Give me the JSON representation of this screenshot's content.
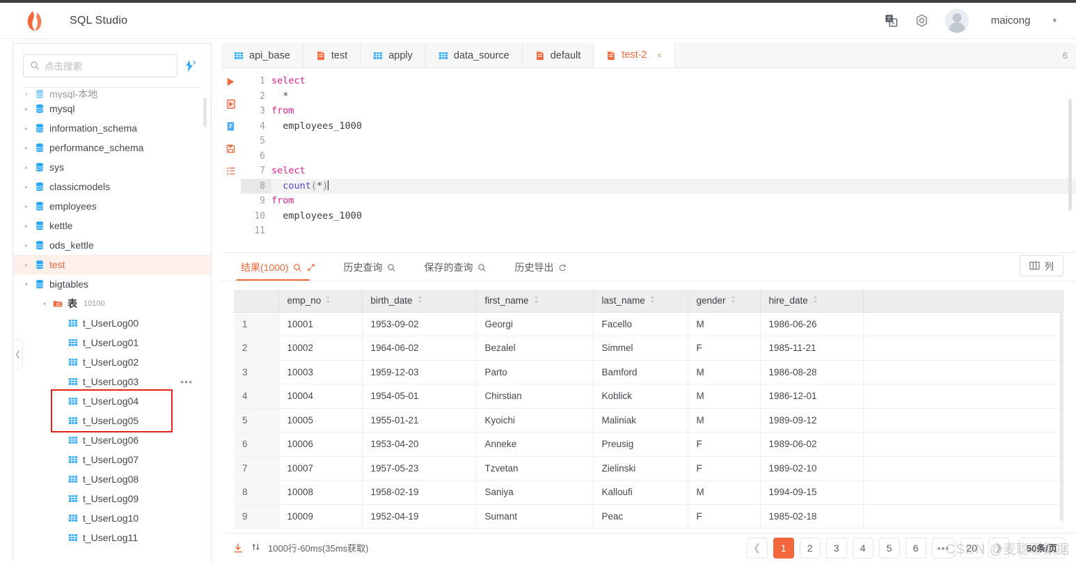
{
  "header": {
    "logo_icon": "flame-logo-icon",
    "title": "SQL Studio",
    "translate_icon": "translate-icon",
    "settings_icon": "target-settings-icon",
    "avatar_icon": "avatar",
    "user_name": "maicong",
    "caret_icon": "chevron-down-icon"
  },
  "sidebar": {
    "search": {
      "placeholder": "点击搜索",
      "icon": "search-icon"
    },
    "refresh_icon": "refresh-lightning-icon",
    "collapse_icon": "chevron-left-icon",
    "tree": [
      {
        "label": "mysql-本地",
        "type": "connection",
        "indent": 0,
        "expanded": true,
        "cut": true
      },
      {
        "label": "mysql",
        "type": "database",
        "indent": 1,
        "expanded": false
      },
      {
        "label": "information_schema",
        "type": "database",
        "indent": 1,
        "expanded": false
      },
      {
        "label": "performance_schema",
        "type": "database",
        "indent": 1,
        "expanded": false
      },
      {
        "label": "sys",
        "type": "database",
        "indent": 1,
        "expanded": false
      },
      {
        "label": "classicmodels",
        "type": "database",
        "indent": 1,
        "expanded": false
      },
      {
        "label": "employees",
        "type": "database",
        "indent": 1,
        "expanded": false
      },
      {
        "label": "kettle",
        "type": "database",
        "indent": 1,
        "expanded": false
      },
      {
        "label": "ods_kettle",
        "type": "database",
        "indent": 1,
        "expanded": false
      },
      {
        "label": "test",
        "type": "database",
        "indent": 1,
        "expanded": false,
        "selected": true
      },
      {
        "label": "bigtables",
        "type": "database",
        "indent": 1,
        "expanded": true
      },
      {
        "label": "表",
        "count": "10100",
        "type": "folder",
        "indent": 2,
        "expanded": true
      },
      {
        "label": "t_UserLog00",
        "type": "table",
        "indent": 3
      },
      {
        "label": "t_UserLog01",
        "type": "table",
        "indent": 3
      },
      {
        "label": "t_UserLog02",
        "type": "table",
        "indent": 3
      },
      {
        "label": "t_UserLog03",
        "type": "table",
        "indent": 3,
        "more": "…"
      },
      {
        "label": "t_UserLog04",
        "type": "table",
        "indent": 3
      },
      {
        "label": "t_UserLog05",
        "type": "table",
        "indent": 3
      },
      {
        "label": "t_UserLog06",
        "type": "table",
        "indent": 3
      },
      {
        "label": "t_UserLog07",
        "type": "table",
        "indent": 3
      },
      {
        "label": "t_UserLog08",
        "type": "table",
        "indent": 3
      },
      {
        "label": "t_UserLog09",
        "type": "table",
        "indent": 3
      },
      {
        "label": "t_UserLog10",
        "type": "table",
        "indent": 3
      },
      {
        "label": "t_UserLog11",
        "type": "table",
        "indent": 3
      }
    ]
  },
  "editor_tabs": {
    "items": [
      {
        "label": "api_base",
        "icon": "table-icon",
        "active": false
      },
      {
        "label": "test",
        "icon": "sql-file-icon",
        "active": false
      },
      {
        "label": "apply",
        "icon": "table-icon",
        "active": false
      },
      {
        "label": "data_source",
        "icon": "table-icon",
        "active": false
      },
      {
        "label": "default",
        "icon": "sql-file-icon",
        "active": false
      },
      {
        "label": "test-2",
        "icon": "sql-file-icon",
        "active": true,
        "close_icon": "close-icon"
      }
    ],
    "right_badge": "6"
  },
  "editor": {
    "gutter_icons": [
      "run-icon",
      "run-to-file-icon",
      "format-doc-icon",
      "save-icon",
      "list-icon"
    ],
    "line_numbers": [
      "1",
      "2",
      "3",
      "4",
      "5",
      "6",
      "7",
      "8",
      "9",
      "10",
      "11"
    ],
    "active_line": 8,
    "lines": [
      {
        "n": 1,
        "tokens": [
          {
            "t": "select",
            "k": "kw"
          }
        ]
      },
      {
        "n": 2,
        "tokens": [
          {
            "t": "  *",
            "k": "pl"
          }
        ]
      },
      {
        "n": 3,
        "tokens": [
          {
            "t": "from",
            "k": "kw"
          }
        ]
      },
      {
        "n": 4,
        "tokens": [
          {
            "t": "  employees_1000",
            "k": "ident"
          }
        ]
      },
      {
        "n": 5,
        "tokens": []
      },
      {
        "n": 6,
        "tokens": []
      },
      {
        "n": 7,
        "tokens": [
          {
            "t": "select",
            "k": "kw"
          }
        ]
      },
      {
        "n": 8,
        "tokens": [
          {
            "t": "  ",
            "k": "pl"
          },
          {
            "t": "count",
            "k": "fn"
          },
          {
            "t": "(",
            "k": "punct"
          },
          {
            "t": "*",
            "k": "pl"
          },
          {
            "t": ")",
            "k": "punct"
          }
        ]
      },
      {
        "n": 9,
        "tokens": [
          {
            "t": "from",
            "k": "kw"
          }
        ]
      },
      {
        "n": 10,
        "tokens": [
          {
            "t": "  employees_1000",
            "k": "ident"
          }
        ]
      },
      {
        "n": 11,
        "tokens": []
      }
    ]
  },
  "result_tabs": [
    {
      "label": "结果(1000)",
      "icons": [
        "search-icon",
        "expand-icon"
      ],
      "active": true
    },
    {
      "label": "历史查询",
      "icons": [
        "search-icon"
      ],
      "active": false
    },
    {
      "label": "保存的查询",
      "icons": [
        "search-icon"
      ],
      "active": false
    },
    {
      "label": "历史导出",
      "icons": [
        "refresh-icon"
      ],
      "active": false
    }
  ],
  "column_button": {
    "label": "列",
    "icon": "columns-icon"
  },
  "grid": {
    "columns": [
      "",
      "emp_no",
      "birth_date",
      "first_name",
      "last_name",
      "gender",
      "hire_date",
      ""
    ],
    "sort_icon": "sort-updown-icon",
    "rows": [
      [
        "1",
        "10001",
        "1953-09-02",
        "Georgi",
        "Facello",
        "M",
        "1986-06-26",
        ""
      ],
      [
        "2",
        "10002",
        "1964-06-02",
        "Bezalel",
        "Simmel",
        "F",
        "1985-11-21",
        ""
      ],
      [
        "3",
        "10003",
        "1959-12-03",
        "Parto",
        "Bamford",
        "M",
        "1986-08-28",
        ""
      ],
      [
        "4",
        "10004",
        "1954-05-01",
        "Chirstian",
        "Koblick",
        "M",
        "1986-12-01",
        ""
      ],
      [
        "5",
        "10005",
        "1955-01-21",
        "Kyoichi",
        "Maliniak",
        "M",
        "1989-09-12",
        ""
      ],
      [
        "6",
        "10006",
        "1953-04-20",
        "Anneke",
        "Preusig",
        "F",
        "1989-06-02",
        ""
      ],
      [
        "7",
        "10007",
        "1957-05-23",
        "Tzvetan",
        "Zielinski",
        "F",
        "1989-02-10",
        ""
      ],
      [
        "8",
        "10008",
        "1958-02-19",
        "Saniya",
        "Kalloufi",
        "M",
        "1994-09-15",
        ""
      ],
      [
        "9",
        "10009",
        "1952-04-19",
        "Sumant",
        "Peac",
        "F",
        "1985-02-18",
        ""
      ]
    ]
  },
  "footer": {
    "download_icon": "download-icon",
    "sort_icon": "sort-arrows-icon",
    "status": "1000行-60ms(35ms获取)",
    "pagination": {
      "prev_icon": "chevron-left-icon",
      "next_icon": "chevron-right-icon",
      "pages": [
        "1",
        "2",
        "3",
        "4",
        "5",
        "6",
        "…",
        "20"
      ],
      "current": "1",
      "page_size": "50条/页"
    }
  },
  "watermark": {
    "csdn": "CSDN",
    "handle": "@麦聪聊数据"
  },
  "colors": {
    "accent": "#f2683c",
    "db_icon": "#2da7f8",
    "annotation_red": "#e8201a",
    "keyword_pink": "#e01e8a",
    "function_purple": "#5b3fd0"
  }
}
